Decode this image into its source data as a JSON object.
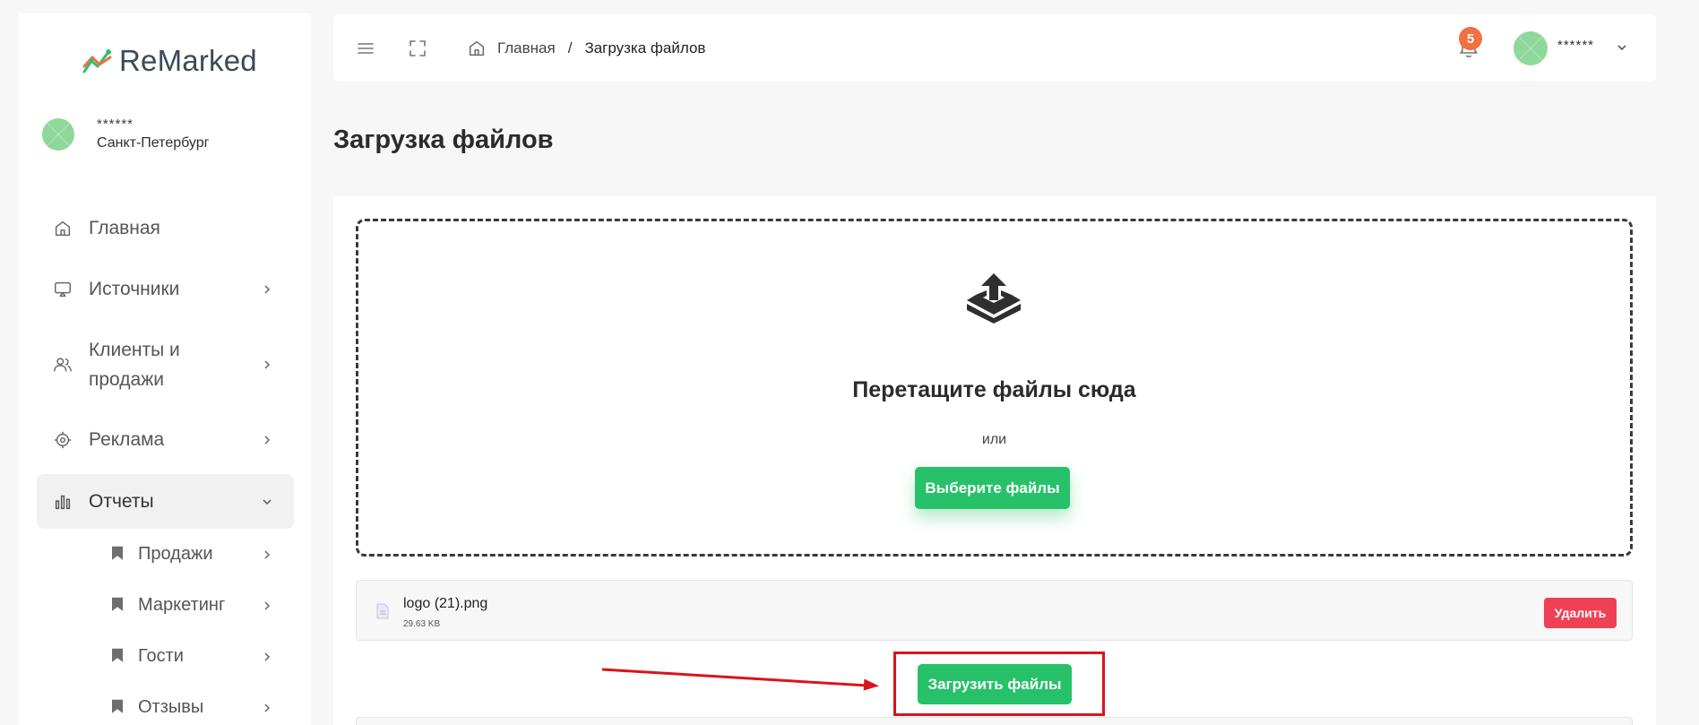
{
  "app": {
    "brand": "ReMarked",
    "colors": {
      "accent": "#27c16a",
      "danger": "#ef4156",
      "badge": "#f07043",
      "highlight": "#d9141c"
    }
  },
  "sidebar": {
    "user": {
      "name": "******",
      "city": "Санкт-Петербург"
    },
    "items": [
      {
        "label": "Главная",
        "icon": "home-icon"
      },
      {
        "label": "Источники",
        "icon": "monitor-icon"
      },
      {
        "label": "Клиенты и продажи",
        "line1": "Клиенты и",
        "line2": "продажи",
        "icon": "users-icon"
      },
      {
        "label": "Реклама",
        "icon": "target-icon"
      },
      {
        "label": "Отчеты",
        "icon": "bar-chart-icon",
        "expanded": true
      }
    ],
    "subitems": [
      {
        "label": "Продажи",
        "icon": "bookmark-icon"
      },
      {
        "label": "Маркетинг",
        "icon": "bookmark-icon"
      },
      {
        "label": "Гости",
        "icon": "bookmark-icon"
      },
      {
        "label": "Отзывы",
        "icon": "bookmark-icon"
      }
    ]
  },
  "topbar": {
    "breadcrumb": {
      "home": "Главная",
      "separator": "/",
      "current": "Загрузка файлов"
    },
    "notifications_count": "5",
    "user_name": "******"
  },
  "page": {
    "title": "Загрузка файлов",
    "dropzone": {
      "title": "Перетащите файлы сюда",
      "or": "или",
      "select_label": "Выберите файлы"
    },
    "files": [
      {
        "name": "logo (21).png",
        "size": "29.63 KB",
        "delete_label": "Удалить"
      }
    ],
    "upload_label": "Загрузить файлы"
  }
}
